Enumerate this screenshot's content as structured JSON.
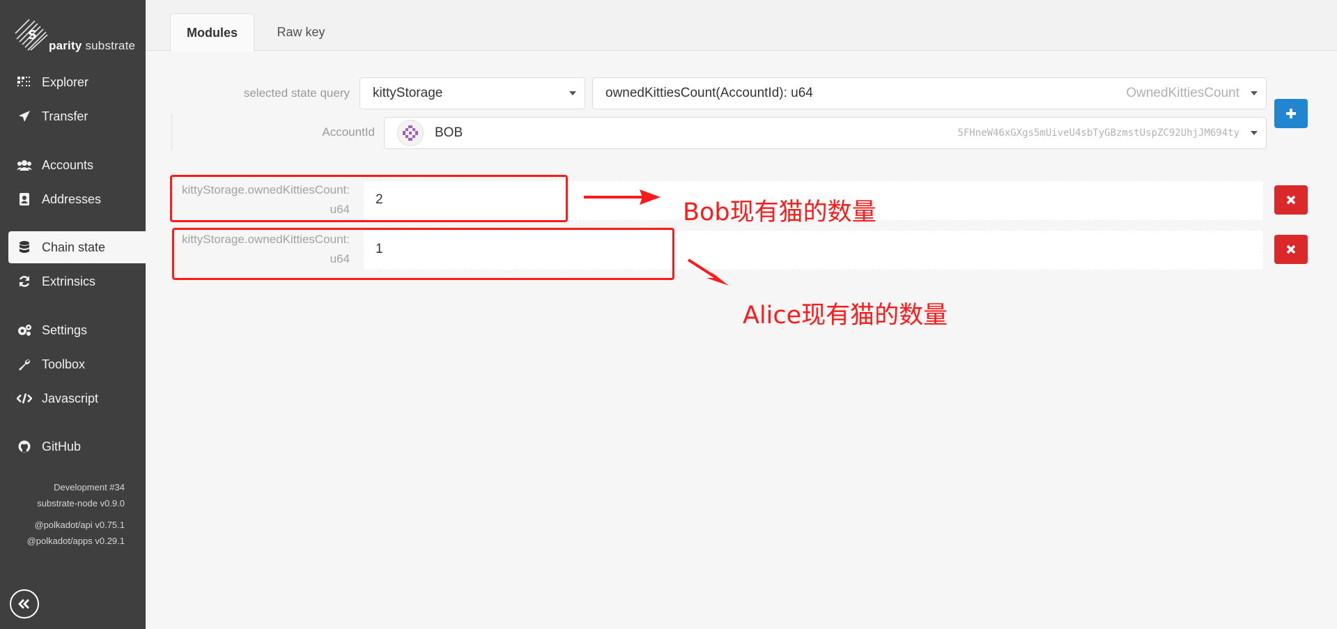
{
  "app": {
    "logo_brand": "parity",
    "logo_product": "substrate"
  },
  "sidebar": {
    "items": [
      {
        "label": "Explorer",
        "icon": "explorer-icon"
      },
      {
        "label": "Transfer",
        "icon": "paper-plane-icon"
      },
      {
        "label": "Accounts",
        "icon": "users-icon"
      },
      {
        "label": "Addresses",
        "icon": "address-book-icon"
      },
      {
        "label": "Chain state",
        "icon": "database-icon",
        "active": true
      },
      {
        "label": "Extrinsics",
        "icon": "sync-icon"
      },
      {
        "label": "Settings",
        "icon": "cogs-icon"
      },
      {
        "label": "Toolbox",
        "icon": "wrench-icon"
      },
      {
        "label": "Javascript",
        "icon": "code-icon"
      },
      {
        "label": "GitHub",
        "icon": "github-icon"
      }
    ],
    "versions": {
      "chain": "Development #34",
      "node": "substrate-node v0.9.0",
      "api": "@polkadot/api v0.75.1",
      "apps": "@polkadot/apps v0.29.1"
    }
  },
  "tabs": [
    {
      "label": "Modules",
      "active": true
    },
    {
      "label": "Raw key",
      "active": false
    }
  ],
  "query": {
    "label": "selected state query",
    "module": "kittyStorage",
    "method": "ownedKittiesCount(AccountId): u64",
    "method_hint": "OwnedKittiesCount",
    "param_label": "AccountId",
    "account_name": "BOB",
    "account_address": "5FHneW46xGXgs5mUiveU4sbTyGBzmstUspZC92UhjJM694ty"
  },
  "results": [
    {
      "label_line1": "kittyStorage.ownedKittiesCount:",
      "label_line2": "u64",
      "value": "2"
    },
    {
      "label_line1": "kittyStorage.ownedKittiesCount:",
      "label_line2": "u64",
      "value": "1"
    }
  ],
  "annotations": {
    "bob": "Bob现有猫的数量",
    "alice": "Alice现有猫的数量",
    "color": "#ff1a1a"
  },
  "colors": {
    "sidebar_bg": "#3f3f3f",
    "add_button": "#2185d0",
    "delete_button": "#db2828"
  }
}
